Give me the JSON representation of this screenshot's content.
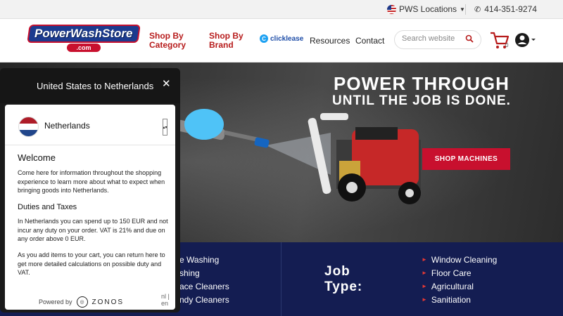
{
  "topbar": {
    "location_label": "PWS Locations",
    "phone": "414-351-9274"
  },
  "header": {
    "logo_text": "PowerWashStore",
    "logo_sub": ".com",
    "nav": {
      "category_line1": "Shop By",
      "category_line2": "Category",
      "brand_line1": "Shop By",
      "brand_line2": "Brand",
      "clicklease": "clicklease",
      "resources": "Resources",
      "contact": "Contact"
    },
    "search_placeholder": "Search website",
    "cart_count": "0"
  },
  "hero": {
    "title_line1": "POWER THROUGH",
    "title_line2": "UNTIL THE JOB IS DONE.",
    "cta": "SHOP MACHINES"
  },
  "job_type": {
    "label_line1": "Job",
    "label_line2": "Type:",
    "left_items": [
      "e Washing",
      "shing",
      "ace Cleaners",
      "ndy Cleaners"
    ],
    "right_items": [
      "Window Cleaning",
      "Floor Care",
      "Agricultural",
      "Sanitiation"
    ]
  },
  "modal": {
    "title": "United States to Netherlands",
    "country": "Netherlands",
    "welcome_heading": "Welcome",
    "welcome_text": "Come here for information throughout the shopping experience to learn more about what to expect when bringing goods into Netherlands.",
    "duties_heading": "Duties and Taxes",
    "duties_text": "In Netherlands you can spend up to 150 EUR and not incur any duty on your order. VAT is 21% and due on any order above 0 EUR.",
    "cart_text": "As you add items to your cart, you can return here to get more detailed calculations on possible duty and VAT.",
    "powered_by": "Powered by",
    "brand": "ZONOS",
    "language": "nl | en"
  }
}
